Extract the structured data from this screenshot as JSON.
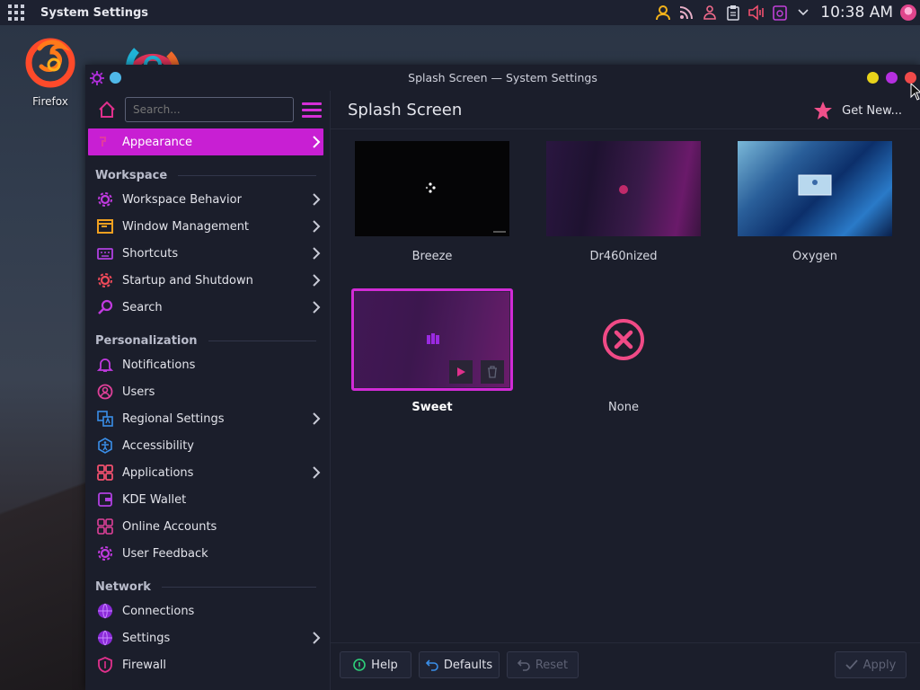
{
  "panel": {
    "title": "System Settings",
    "clock": "10:38 AM",
    "tray_icons": [
      "user-icon",
      "rss-icon",
      "people-icon",
      "clipboard-icon",
      "volume-icon",
      "notes-icon",
      "chevron-down-icon"
    ]
  },
  "desktop": {
    "icons": [
      {
        "name": "firefox",
        "label": "Firefox"
      },
      {
        "name": "chrome",
        "label": ""
      }
    ]
  },
  "window": {
    "title": "Splash Screen — System Settings",
    "controls": {
      "minimize": "#e8d21a",
      "maximize": "#b52fe0",
      "close": "#f04a4a"
    }
  },
  "sidebar": {
    "search_placeholder": "Search...",
    "active_item": {
      "label": "Appearance",
      "icon": "paintbrush-icon"
    },
    "sections": [
      {
        "title": "Workspace",
        "items": [
          {
            "label": "Workspace Behavior",
            "icon": "gear-icon",
            "chevron": true
          },
          {
            "label": "Window Management",
            "icon": "window-icon",
            "chevron": true
          },
          {
            "label": "Shortcuts",
            "icon": "keyboard-icon",
            "chevron": true
          },
          {
            "label": "Startup and Shutdown",
            "icon": "power-gear-icon",
            "chevron": true
          },
          {
            "label": "Search",
            "icon": "magnifier-icon",
            "chevron": true
          }
        ]
      },
      {
        "title": "Personalization",
        "items": [
          {
            "label": "Notifications",
            "icon": "bell-icon",
            "chevron": false
          },
          {
            "label": "Users",
            "icon": "user-circle-icon",
            "chevron": false
          },
          {
            "label": "Regional Settings",
            "icon": "language-icon",
            "chevron": true
          },
          {
            "label": "Accessibility",
            "icon": "accessibility-icon",
            "chevron": false
          },
          {
            "label": "Applications",
            "icon": "apps-grid-icon",
            "chevron": true
          },
          {
            "label": "KDE Wallet",
            "icon": "wallet-icon",
            "chevron": false
          },
          {
            "label": "Online Accounts",
            "icon": "accounts-grid-icon",
            "chevron": false
          },
          {
            "label": "User Feedback",
            "icon": "feedback-gear-icon",
            "chevron": false
          }
        ]
      },
      {
        "title": "Network",
        "items": [
          {
            "label": "Connections",
            "icon": "globe-icon",
            "chevron": false
          },
          {
            "label": "Settings",
            "icon": "network-settings-icon",
            "chevron": true
          },
          {
            "label": "Firewall",
            "icon": "shield-icon",
            "chevron": false
          }
        ]
      }
    ]
  },
  "main": {
    "title": "Splash Screen",
    "get_new": "Get New...",
    "themes": [
      {
        "label": "Breeze",
        "selected": false
      },
      {
        "label": "Dr460nized",
        "selected": false
      },
      {
        "label": "Oxygen",
        "selected": false
      },
      {
        "label": "Sweet",
        "selected": true
      },
      {
        "label": "None",
        "selected": false
      }
    ],
    "accent": "#d12bd6"
  },
  "footer": {
    "help": "Help",
    "defaults": "Defaults",
    "reset": "Reset",
    "apply": "Apply"
  }
}
